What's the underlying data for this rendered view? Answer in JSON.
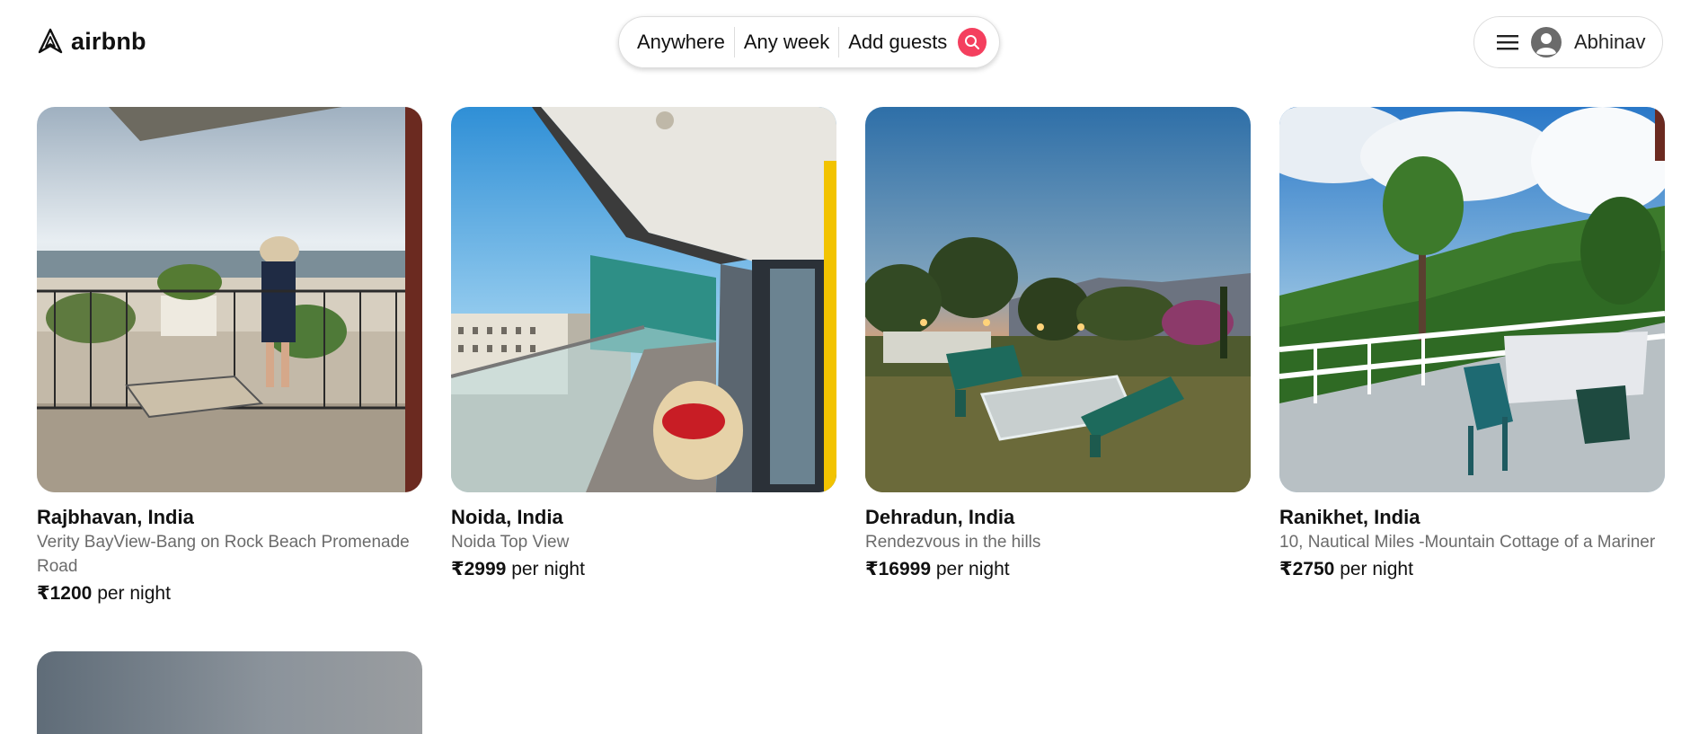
{
  "header": {
    "logo_text": "airbnb",
    "search": {
      "location": "Anywhere",
      "dates": "Any week",
      "guests": "Add guests"
    },
    "user": {
      "name": "Abhinav"
    }
  },
  "colors": {
    "brand": "#f43f5e"
  },
  "listings": [
    {
      "title": "Rajbhavan, India",
      "description": "Verity BayView-Bang on Rock Beach Promenade Road",
      "price": "₹1200",
      "price_suffix": "per night",
      "image": "balcony overlooking the sea with a woman in a hat"
    },
    {
      "title": "Noida, India",
      "description": "Noida Top View",
      "price": "₹2999",
      "price_suffix": "per night",
      "image": "high-rise balcony with a wicker chair"
    },
    {
      "title": "Dehradun, India",
      "description": "Rendezvous in the hills",
      "price": "₹16999",
      "price_suffix": "per night",
      "image": "lawn with green benches at dusk"
    },
    {
      "title": "Ranikhet, India",
      "description": "10, Nautical Miles -Mountain Cottage of a Mariner",
      "price": "₹2750",
      "price_suffix": "per night",
      "image": "terrace with green chairs overlooking forested hills"
    },
    {
      "image": "partially visible listing photo"
    }
  ]
}
